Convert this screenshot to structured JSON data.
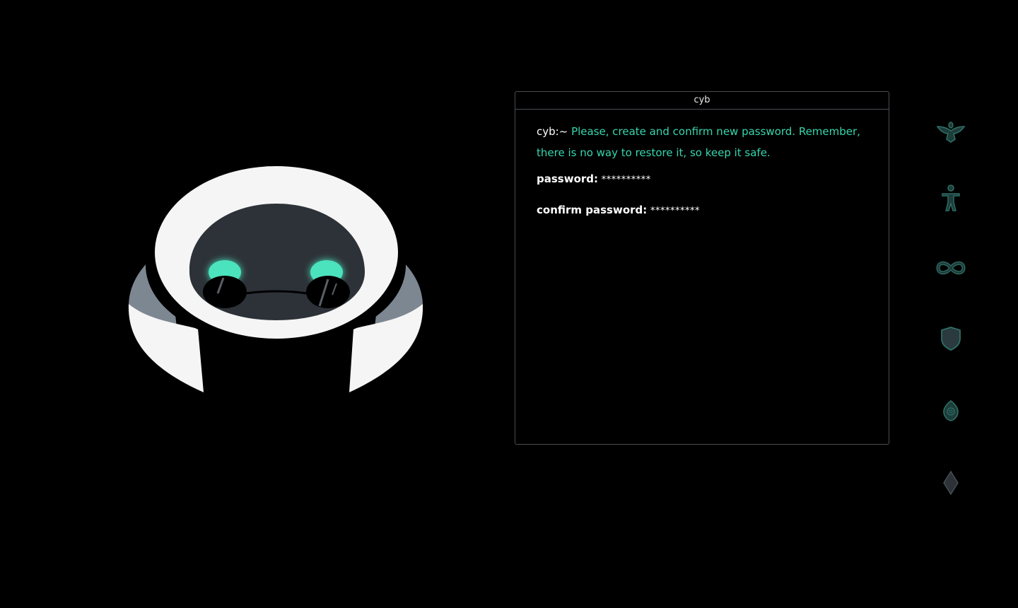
{
  "terminal": {
    "title": "cyb",
    "prompt": "cyb:~",
    "message": "Please, create and confirm new password. Remember, there is no way to restore it, so keep it safe.",
    "fields": [
      {
        "label": "password:",
        "value": "**********"
      },
      {
        "label": "confirm password:",
        "value": "**********"
      }
    ]
  },
  "side_nav": {
    "items": [
      {
        "icon": "bird-icon"
      },
      {
        "icon": "human-figure-icon"
      },
      {
        "icon": "infinity-icon"
      },
      {
        "icon": "shield-icon"
      },
      {
        "icon": "seed-eye-icon"
      },
      {
        "icon": "diamond-icon"
      }
    ]
  },
  "colors": {
    "background": "#000000",
    "accent": "#36d6ae",
    "icon_stroke": "#2f6f66",
    "icon_fill": "#1d3c3a",
    "robot_body": "#f5f5f5",
    "robot_face": "#2d3238",
    "robot_accent_gray": "#7d8792"
  }
}
